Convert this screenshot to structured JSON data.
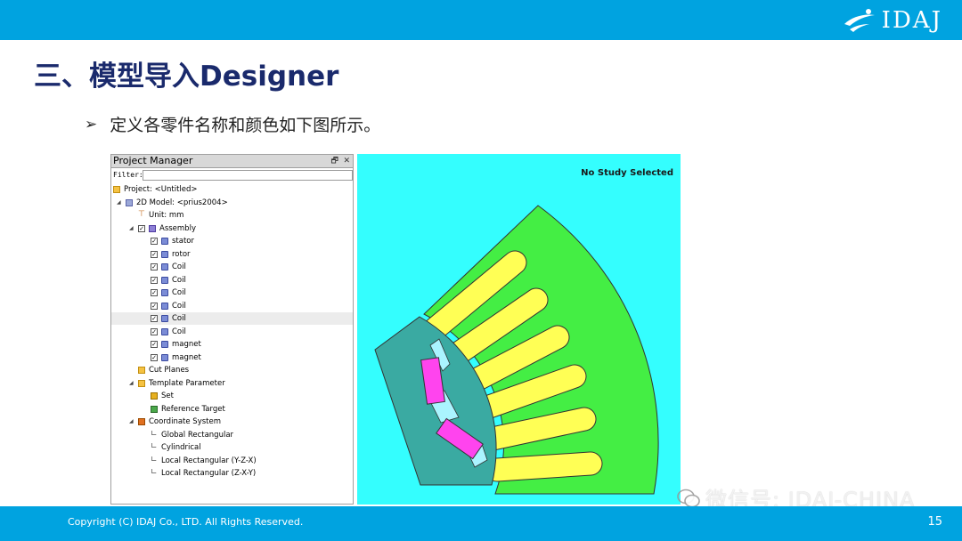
{
  "header": {
    "logo_text": "IDAJ"
  },
  "slide": {
    "title": "三、模型导入Designer",
    "bullet_mark": "➢",
    "bullet_text": "定义各零件名称和颜色如下图所示。"
  },
  "project_manager": {
    "title": "Project Manager",
    "pin_glyph": "🗗",
    "close_glyph": "✕",
    "filter_label": "Filter:",
    "filter_value": "",
    "tree": [
      {
        "label": "Project: <Untitled>",
        "indent": 0,
        "icon": "folder",
        "checkbox": false,
        "twisty": ""
      },
      {
        "label": "2D Model: <prius2004>",
        "indent": 1,
        "icon": "model",
        "checkbox": false,
        "twisty": "◢"
      },
      {
        "label": "Unit: mm",
        "indent": 2,
        "icon": "unit",
        "checkbox": false,
        "twisty": ""
      },
      {
        "label": "Assembly",
        "indent": 2,
        "icon": "assembly",
        "checkbox": true,
        "twisty": "◢"
      },
      {
        "label": "stator",
        "indent": 3,
        "icon": "part",
        "checkbox": true,
        "twisty": ""
      },
      {
        "label": "rotor",
        "indent": 3,
        "icon": "part",
        "checkbox": true,
        "twisty": ""
      },
      {
        "label": "Coil",
        "indent": 3,
        "icon": "part",
        "checkbox": true,
        "twisty": ""
      },
      {
        "label": "Coil",
        "indent": 3,
        "icon": "part",
        "checkbox": true,
        "twisty": ""
      },
      {
        "label": "Coil",
        "indent": 3,
        "icon": "part",
        "checkbox": true,
        "twisty": ""
      },
      {
        "label": "Coil",
        "indent": 3,
        "icon": "part",
        "checkbox": true,
        "twisty": ""
      },
      {
        "label": "Coil",
        "indent": 3,
        "icon": "part",
        "checkbox": true,
        "twisty": "",
        "selected": true
      },
      {
        "label": "Coil",
        "indent": 3,
        "icon": "part",
        "checkbox": true,
        "twisty": ""
      },
      {
        "label": "magnet",
        "indent": 3,
        "icon": "part",
        "checkbox": true,
        "twisty": ""
      },
      {
        "label": "magnet",
        "indent": 3,
        "icon": "part",
        "checkbox": true,
        "twisty": ""
      },
      {
        "label": "Cut Planes",
        "indent": 2,
        "icon": "folder",
        "checkbox": false,
        "twisty": ""
      },
      {
        "label": "Template Parameter",
        "indent": 2,
        "icon": "folder",
        "checkbox": false,
        "twisty": "◢"
      },
      {
        "label": "Set",
        "indent": 3,
        "icon": "set",
        "checkbox": false,
        "twisty": ""
      },
      {
        "label": "Reference Target",
        "indent": 3,
        "icon": "ref",
        "checkbox": false,
        "twisty": ""
      },
      {
        "label": "Coordinate System",
        "indent": 2,
        "icon": "cs",
        "checkbox": false,
        "twisty": "◢"
      },
      {
        "label": "Global Rectangular",
        "indent": 3,
        "icon": "axes",
        "checkbox": false,
        "twisty": ""
      },
      {
        "label": "Cylindrical",
        "indent": 3,
        "icon": "axes",
        "checkbox": false,
        "twisty": ""
      },
      {
        "label": "Local Rectangular (Y-Z-X)",
        "indent": 3,
        "icon": "axes",
        "checkbox": false,
        "twisty": ""
      },
      {
        "label": "Local Rectangular (Z-X-Y)",
        "indent": 3,
        "icon": "axes",
        "checkbox": false,
        "twisty": ""
      }
    ]
  },
  "viewport": {
    "status_text": "No Study Selected",
    "colors": {
      "background": "#34fefe",
      "stator": "#44ee44",
      "rotor": "#3aaaa2",
      "coil": "#ffff55",
      "magnet": "#ff44ee",
      "rotor_pocket": "#aaf4ff",
      "outline": "#333333"
    }
  },
  "footer": {
    "copyright": "Copyright (C) IDAJ Co., LTD. All Rights Reserved.",
    "page_number": "15",
    "watermark": "微信号: IDAJ-CHINA"
  },
  "colors": {
    "brand_blue": "#00a3e0",
    "title_navy": "#1a2a6c"
  }
}
